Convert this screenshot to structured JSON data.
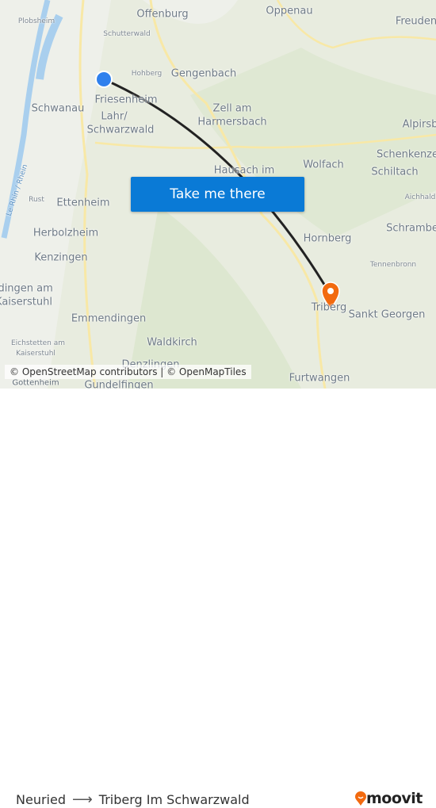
{
  "map": {
    "labels": {
      "offenburg": "Offenburg",
      "oppenau": "Oppenau",
      "freuden": "Freuden",
      "plobsheim": "Plobsheim",
      "schutterwald": "Schutterwald",
      "hohberg": "Hohberg",
      "gengenbach": "Gengenbach",
      "schwanau": "Schwanau",
      "friesenheim": "Friesenheim",
      "lahr1": "Lahr/",
      "lahr2": "Schwarzwald",
      "zell1": "Zell am",
      "zell2": "Harmersbach",
      "alpirsbach": "Alpirsb",
      "schenkenzell": "Schenkenze",
      "schiltach": "Schiltach",
      "wolfach": "Wolfach",
      "hausach": "Hausach im",
      "aichhalden": "Aichhald",
      "rust": "Rust",
      "ettenheim": "Ettenheim",
      "herbolzheim": "Herbolzheim",
      "kenzingen": "Kenzingen",
      "hornberg": "Hornberg",
      "schramberg": "Schrambe",
      "tennenbronn": "Tennenbronn",
      "endingen1": "ndingen am",
      "endingen2": "Kaiserstuhl",
      "triberg": "Triberg",
      "sanktgeorgen": "Sankt Georgen",
      "emmendingen": "Emmendingen",
      "eichstetten1": "Eichstetten am",
      "eichstetten2": "Kaiserstuhl",
      "waldkirch": "Waldkirch",
      "denzlingen": "Denzlingen",
      "furtwangen": "Furtwangen",
      "gundelfingen": "Gundelfingen",
      "gottenheim": "Gottenheim",
      "rhein": "Le Rhin / Rhein"
    },
    "attribution": "© OpenStreetMap contributors | © OpenMapTiles",
    "cta_label": "Take me there",
    "origin_color": "#2f80ed",
    "destination_color": "#f26a0f"
  },
  "footer": {
    "from": "Neuried",
    "arrow": "⟶",
    "to": "Triberg Im Schwarzwald",
    "brand": "moovit",
    "brand_color": "#f26a0f"
  }
}
